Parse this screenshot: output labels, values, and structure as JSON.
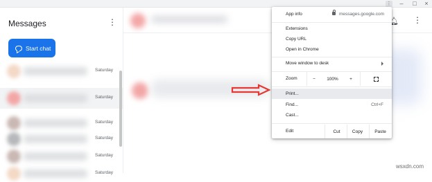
{
  "sidebar": {
    "title": "Messages",
    "start_chat": "Start chat",
    "conversations": [
      {
        "date": "Saturday",
        "avatar_color": "#f3d9c6",
        "selected": false
      },
      {
        "date": "Saturday",
        "avatar_color": "#f3a6a6",
        "selected": true
      },
      {
        "date": "Saturday",
        "avatar_color": "#c9b8b3",
        "selected": false
      },
      {
        "date": "Saturday",
        "avatar_color": "#b7b8bb",
        "selected": false
      },
      {
        "date": "Saturday",
        "avatar_color": "#c9b8b3",
        "selected": false
      },
      {
        "date": "Saturday",
        "avatar_color": "#f3d9c6",
        "selected": false
      }
    ]
  },
  "colors": {
    "accent": "#1a73e8",
    "arrow": "#e53935"
  },
  "menu": {
    "app_info": "App info",
    "app_url": "messages.google.com",
    "extensions": "Extensions",
    "copy_url": "Copy URL",
    "open_in_chrome": "Open in Chrome",
    "move_window": "Move window to desk",
    "zoom_label": "Zoom",
    "zoom_minus": "−",
    "zoom_value": "100%",
    "zoom_plus": "+",
    "print": "Print...",
    "find": "Find...",
    "find_shortcut": "Ctrl+F",
    "cast": "Cast...",
    "edit_label": "Edit",
    "cut": "Cut",
    "copy": "Copy",
    "paste": "Paste"
  },
  "watermark": "wsxdn.com"
}
